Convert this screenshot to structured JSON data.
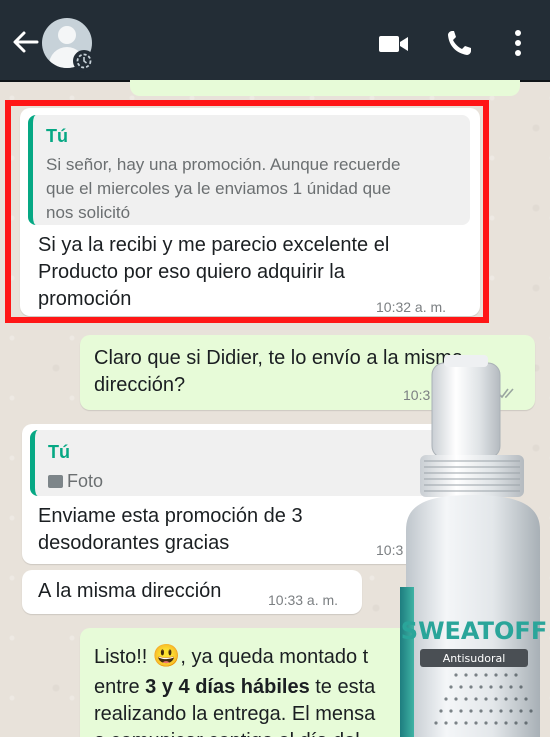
{
  "header": {
    "back_icon": "arrow-left-icon",
    "avatar_icon": "default-avatar-icon",
    "video_icon": "video-camera-icon",
    "call_icon": "phone-icon",
    "menu_icon": "vertical-dots-icon",
    "background": "#232d36"
  },
  "messages": [
    {
      "quote_author": "Tú",
      "quote_line1": "Si señor, hay una promoción. Aunque recuerde",
      "quote_line2": "que el miercoles ya le enviamos 1 únidad que",
      "quote_line3": "nos solicitó",
      "line1": "Si ya la recibi y me parecio excelente el",
      "line2": "Producto por eso quiero adquirir la",
      "line3": "promoción",
      "time": "10:32 a. m."
    },
    {
      "line1": "Claro que si Didier, te lo envío a la misma",
      "line2": "dirección?",
      "time": "10:3"
    },
    {
      "quote_author": "Tú",
      "quote_label": "Foto",
      "line1": "Enviame esta promoción de 3",
      "line2": "desodorantes gracias",
      "time": "10:3"
    },
    {
      "line1": "A la misma dirección",
      "time": "10:33 a. m."
    },
    {
      "line1_a": "Listo!! ",
      "emoji": "😃",
      "line1_b": ", ya queda montado t",
      "line2_a": "entre ",
      "line2_bold": "3 y 4 días hábiles",
      "line2_b": " te esta",
      "line3": "realizando la entrega. El mensa",
      "line4": "a comunicar contigo el día del"
    }
  ],
  "product": {
    "brand": "SWEATOFF",
    "subtitle": "Antisudoral"
  },
  "colors": {
    "incoming": "#ffffff",
    "outgoing": "#e7fbd8",
    "quote_accent": "#06a884",
    "highlight": "#ff1616"
  }
}
